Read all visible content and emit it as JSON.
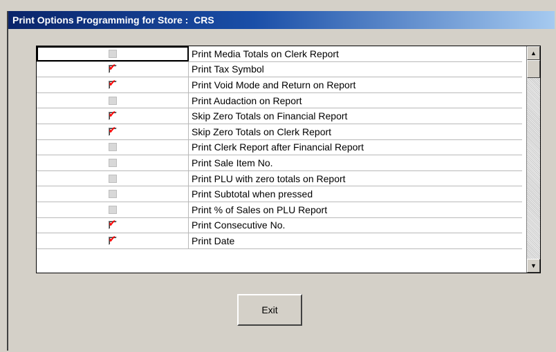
{
  "window": {
    "title": "Print Options Programming for Store :  CRS"
  },
  "options": [
    {
      "label": "Print Media Totals on Clerk Report",
      "checked": false
    },
    {
      "label": "Print Tax Symbol",
      "checked": true
    },
    {
      "label": "Print Void Mode and Return on Report",
      "checked": true
    },
    {
      "label": "Print Audaction on Report",
      "checked": false
    },
    {
      "label": "Skip Zero Totals on Financial Report",
      "checked": true
    },
    {
      "label": "Skip Zero Totals on Clerk Report",
      "checked": true
    },
    {
      "label": "Print Clerk Report after Financial Report",
      "checked": false
    },
    {
      "label": "Print Sale Item No.",
      "checked": false
    },
    {
      "label": "Print PLU with zero totals on Report",
      "checked": false
    },
    {
      "label": "Print Subtotal when pressed",
      "checked": false
    },
    {
      "label": "Print % of Sales on PLU Report",
      "checked": false
    },
    {
      "label": "Print Consecutive No.",
      "checked": true
    },
    {
      "label": "Print Date",
      "checked": true
    }
  ],
  "buttons": {
    "exit_label": "Exit"
  },
  "colors": {
    "title_bar": "#0a246a",
    "check_mark": "#ff0000",
    "window_bg": "#d4d0c8"
  }
}
